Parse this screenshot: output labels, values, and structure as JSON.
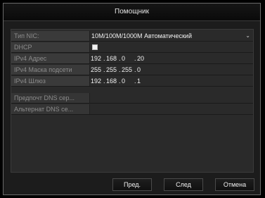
{
  "window": {
    "title": "Помощник"
  },
  "fields": {
    "nic_type": {
      "label": "Тип NIC:",
      "value": "10M/100M/1000M Автоматический",
      "caret": "⌄"
    },
    "dhcp": {
      "label": "DHCP",
      "checked": false
    },
    "ipv4_address": {
      "label": "IPv4 Адрес",
      "octets": [
        "192",
        "168",
        "0",
        "20"
      ]
    },
    "ipv4_mask": {
      "label": "IPv4 Маска подсети",
      "octets": [
        "255",
        "255",
        "255",
        "0"
      ]
    },
    "ipv4_gateway": {
      "label": "IPv4 Шлюз",
      "octets": [
        "192",
        "168",
        "0",
        "1"
      ]
    },
    "preferred_dns": {
      "label": "Предпочт DNS сер...",
      "value": ""
    },
    "alternate_dns": {
      "label": "Альтернат DNS се...",
      "value": ""
    }
  },
  "buttons": {
    "prev": "Пред.",
    "next": "След",
    "cancel": "Отмена"
  }
}
